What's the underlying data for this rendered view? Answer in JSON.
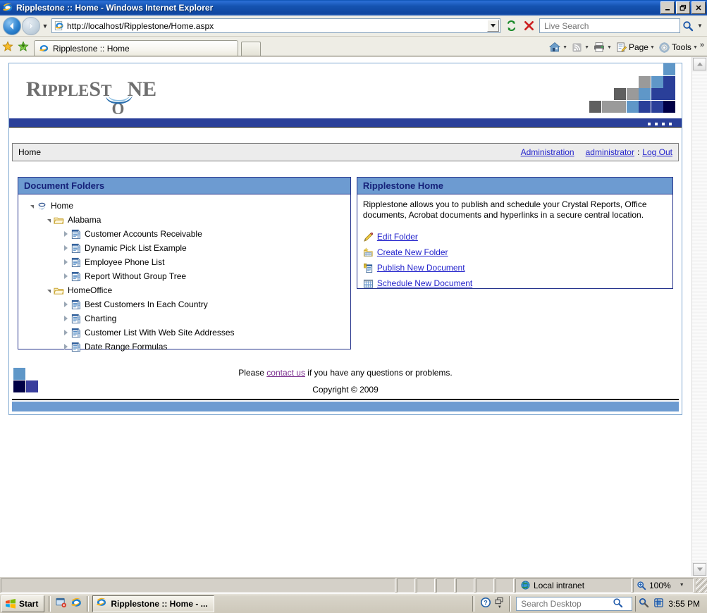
{
  "window": {
    "title": "Ripplestone :: Home - Windows Internet Explorer",
    "minimize_label": "_",
    "maximize_label": "❐",
    "close_label": "✕"
  },
  "browser": {
    "back_label": "◀",
    "forward_label": "▶",
    "history_caret": "▼",
    "url": "http://localhost/Ripplestone/Home.aspx",
    "addr_dropdown_caret": "▼",
    "refresh_icon": "refresh-icon",
    "stop_icon": "stop-icon",
    "search_placeholder": "Live Search",
    "search_value": "",
    "search_go_icon": "magnifier-icon",
    "search_caret": "▼",
    "tab_label": "Ripplestone :: Home",
    "newtab_label": "",
    "favorites_star": "★",
    "add_favorite": "✚",
    "commands": [
      {
        "label": "",
        "icon": "home-icon",
        "caret": "▼"
      },
      {
        "label": "",
        "icon": "feeds-icon",
        "caret": "▼"
      },
      {
        "label": "",
        "icon": "print-icon",
        "caret": "▼"
      },
      {
        "label": "Page",
        "icon": "page-icon",
        "caret": "▼"
      },
      {
        "label": "Tools",
        "icon": "gear-icon",
        "caret": "▼"
      }
    ],
    "overflow_label": "»"
  },
  "app": {
    "logo": {
      "part1": "R",
      "part2": "IPPLE",
      "part3": "S",
      "part4": "T",
      "part5": "O",
      "part6": "NE"
    },
    "colors": {
      "navy": "#2a3f99",
      "dark_navy": "#000046",
      "steel_blue": "#6d9bd1",
      "gray_dark": "#5f5f5f",
      "gray_mid": "#9a9a9a",
      "panel_border": "#26348c",
      "link": "#2222cc",
      "visited_link": "#7b2f8e"
    },
    "banner_squares": [
      {
        "col": 0,
        "row": 3,
        "color": "#5f5f5f"
      },
      {
        "col": 1,
        "row": 3,
        "color": "#9a9a9a"
      },
      {
        "col": 2,
        "row": 3,
        "color": "#9a9a9a"
      },
      {
        "col": 3,
        "row": 3,
        "color": "#5f97c8"
      },
      {
        "col": 4,
        "row": 3,
        "color": "#2a3f99"
      },
      {
        "col": 5,
        "row": 3,
        "color": "#2a3f99"
      },
      {
        "col": 6,
        "row": 3,
        "color": "#000046"
      },
      {
        "col": 2,
        "row": 2,
        "color": "#5f5f5f"
      },
      {
        "col": 3,
        "row": 2,
        "color": "#9a9a9a"
      },
      {
        "col": 4,
        "row": 2,
        "color": "#5f97c8"
      },
      {
        "col": 5,
        "row": 2,
        "color": "#2a3f99"
      },
      {
        "col": 6,
        "row": 2,
        "color": "#2a3f99"
      },
      {
        "col": 4,
        "row": 1,
        "color": "#9a9a9a"
      },
      {
        "col": 5,
        "row": 1,
        "color": "#5f97c8"
      },
      {
        "col": 6,
        "row": 1,
        "color": "#2a3f99"
      },
      {
        "col": 6,
        "row": 0,
        "color": "#5f97c8"
      }
    ],
    "nav": {
      "breadcrumb": "Home",
      "administration_label": "Administration",
      "user_label": "administrator",
      "separator": ":",
      "logout_label": "Log Out"
    },
    "folders_panel": {
      "title": "Document Folders",
      "tree": [
        {
          "label": "Home",
          "depth": 0,
          "icon": "ripplestone-home-icon",
          "expander": "open"
        },
        {
          "label": "Alabama",
          "depth": 1,
          "icon": "folder-icon",
          "expander": "open"
        },
        {
          "label": "Customer Accounts Receivable",
          "depth": 2,
          "icon": "document-icon",
          "expander": "closed"
        },
        {
          "label": "Dynamic Pick List Example",
          "depth": 2,
          "icon": "document-icon",
          "expander": "closed"
        },
        {
          "label": "Employee Phone List",
          "depth": 2,
          "icon": "document-icon",
          "expander": "closed"
        },
        {
          "label": "Report Without Group Tree",
          "depth": 2,
          "icon": "document-icon",
          "expander": "closed"
        },
        {
          "label": "HomeOffice",
          "depth": 1,
          "icon": "folder-icon",
          "expander": "open"
        },
        {
          "label": "Best Customers In Each Country",
          "depth": 2,
          "icon": "document-icon",
          "expander": "closed"
        },
        {
          "label": "Charting",
          "depth": 2,
          "icon": "document-icon",
          "expander": "closed"
        },
        {
          "label": "Customer List With Web Site Addresses",
          "depth": 2,
          "icon": "document-icon",
          "expander": "closed"
        },
        {
          "label": "Date Range Formulas",
          "depth": 2,
          "icon": "document-icon",
          "expander": "closed"
        }
      ]
    },
    "home_panel": {
      "title": "Ripplestone Home",
      "description": "Ripplestone allows you to publish and schedule your Crystal Reports, Office documents, Acrobat documents and hyperlinks in a secure central location.",
      "actions": [
        {
          "label": "Edit Folder",
          "icon": "pencil-icon"
        },
        {
          "label": "Create New Folder",
          "icon": "new-folder-icon"
        },
        {
          "label": "Publish New Document",
          "icon": "publish-document-icon"
        },
        {
          "label": "Schedule New Document",
          "icon": "calendar-icon"
        }
      ]
    },
    "footer": {
      "please_text": "Please ",
      "contact_link": "contact us",
      "after_text": " if you have any questions or problems.",
      "copyright": "Copyright © 2009",
      "squares": [
        {
          "col": 0,
          "row": 0,
          "color": "#5f97c8"
        },
        {
          "col": 0,
          "row": 1,
          "color": "#000046"
        },
        {
          "col": 1,
          "row": 1,
          "color": "#3a3f9e"
        }
      ]
    }
  },
  "statusbar": {
    "zone_label": "Local intranet",
    "zone_icon": "globe-icon",
    "zoom_label": "100%",
    "zoom_icon": "zoom-icon",
    "zoom_caret": "▼"
  },
  "taskbar": {
    "start_label": "Start",
    "quick_launch": [
      {
        "icon": "show-desktop-icon"
      },
      {
        "icon": "internet-explorer-icon"
      }
    ],
    "task_label": "Ripplestone :: Home - ...",
    "task_icon": "internet-explorer-icon",
    "help_icon": "help-icon",
    "window-switch_icon": "window-switch-icon",
    "switch_caret": "▼",
    "search_placeholder": "Search Desktop",
    "search_value": "",
    "search_icon": "magnifier-icon",
    "tray_icons": [
      "magnifier-icon",
      "app-icon"
    ],
    "clock": "3:55 PM"
  }
}
